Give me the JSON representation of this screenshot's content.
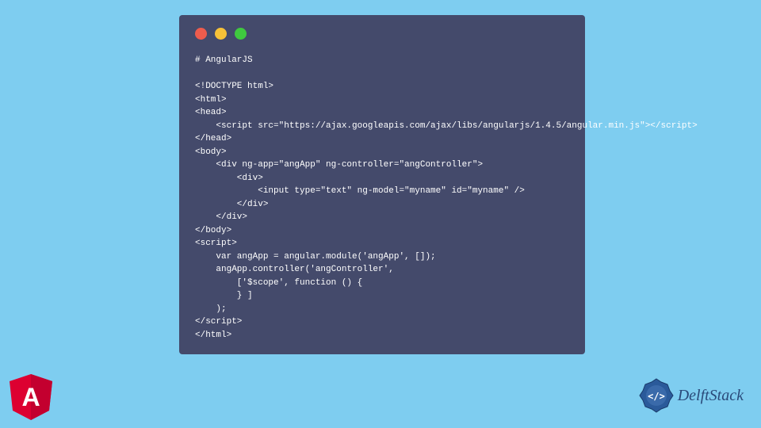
{
  "code": {
    "title": "# AngularJS",
    "lines": [
      "<!DOCTYPE html>",
      "<html>",
      "<head>",
      "    <script src=\"https://ajax.googleapis.com/ajax/libs/angularjs/1.4.5/angular.min.js\"></script>",
      "</head>",
      "<body>",
      "    <div ng-app=\"angApp\" ng-controller=\"angController\">",
      "        <div>",
      "            <input type=\"text\" ng-model=\"myname\" id=\"myname\" />",
      "        </div>",
      "    </div>",
      "</body>",
      "<script>",
      "    var angApp = angular.module('angApp', []);",
      "    angApp.controller('angController',",
      "        ['$scope', function () {",
      "        } ]",
      "    );",
      "</script>",
      "</html>"
    ]
  },
  "logos": {
    "angular_letter": "A",
    "delftstack_text": "DelftStack"
  },
  "colors": {
    "background": "#7ecdf0",
    "window": "#444a6b",
    "dot_red": "#ed5c4d",
    "dot_yellow": "#f7c138",
    "dot_green": "#3fc93f"
  }
}
